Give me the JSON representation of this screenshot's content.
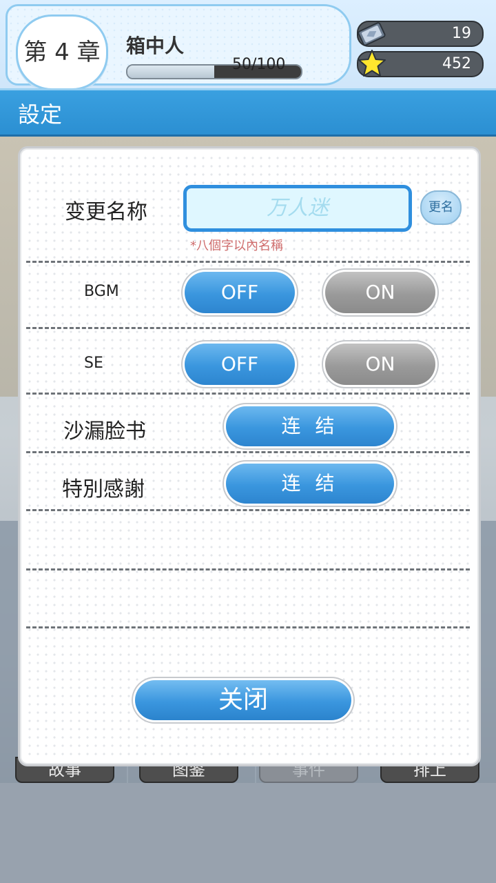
{
  "hud": {
    "chapter": "第 4 章",
    "chapter_title": "箱中人",
    "progress_text": "50/100",
    "progress_value": 0.5,
    "gems": "19",
    "stars": "452",
    "gem_icon": "gem-card-icon",
    "star_icon": "star-icon"
  },
  "title_bar": {
    "title": "設定"
  },
  "settings": {
    "rename": {
      "label": "变更名称",
      "placeholder": "万人迷",
      "button": "更名",
      "hint": "*八個字以內名稱"
    },
    "bgm": {
      "label": "BGM",
      "off": "OFF",
      "on": "ON",
      "selected": "OFF"
    },
    "se": {
      "label": "SE",
      "off": "OFF",
      "on": "ON",
      "selected": "OFF"
    },
    "facebook": {
      "label": "沙漏脸书",
      "button": "连 结"
    },
    "thanks": {
      "label": "特別感謝",
      "button": "连 结"
    },
    "close": "关闭"
  },
  "bottom_tabs": [
    "故事",
    "图鉴",
    "事件",
    "排上"
  ],
  "colors": {
    "accent": "#3a96de",
    "title_bar": "#2b8fd2",
    "hint": "#cf6d6d"
  }
}
